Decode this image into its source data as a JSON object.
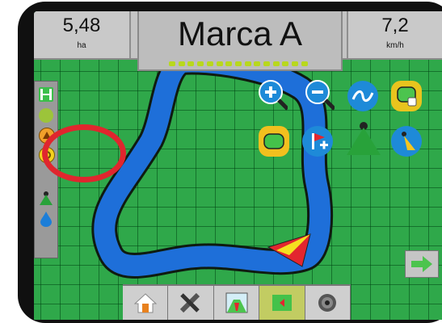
{
  "header": {
    "area_value": "5,48",
    "area_unit": "ha",
    "title": "Marca A",
    "speed_value": "7,2",
    "speed_unit": "km/h"
  },
  "lightbar": {
    "led_count": 15,
    "led_color": "#b8d81d"
  },
  "left_toolbar": {
    "icons": [
      "boundary-bracket-icon",
      "marker-a-icon",
      "marker-b-icon",
      "marker-c-icon",
      "vehicle-icon",
      "water-drop-icon"
    ]
  },
  "map_tools": {
    "row1": [
      "zoom-in-icon",
      "zoom-out-icon",
      "guidance-mode-icon",
      "clear-boundary-icon"
    ],
    "row2": [
      "boundary-icon",
      "add-flag-icon",
      "perspective-view-icon",
      "overhead-view-icon"
    ]
  },
  "bottom_tabs": [
    "home-icon",
    "tools-icon",
    "field-guidance-icon",
    "map-view-icon",
    "camera-icon"
  ],
  "active_tab": "map-view-icon",
  "colors": {
    "field": "#2fa84a",
    "coverage_path": "#1e6fd9",
    "highlight_ring": "#e0262e"
  }
}
